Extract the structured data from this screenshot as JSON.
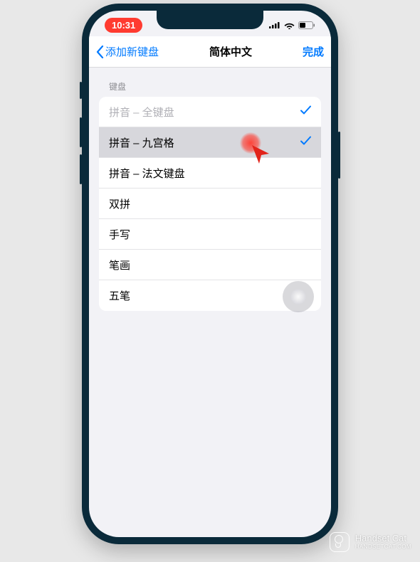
{
  "status": {
    "time": "10:31"
  },
  "nav": {
    "back": "添加新键盘",
    "title": "简体中文",
    "done": "完成"
  },
  "section": {
    "header": "键盘"
  },
  "keyboards": [
    {
      "label": "拼音 – 全键盘",
      "checked": true
    },
    {
      "label": "拼音 – 九宫格",
      "checked": true
    },
    {
      "label": "拼音 – 法文键盘",
      "checked": false
    },
    {
      "label": "双拼",
      "checked": false
    },
    {
      "label": "手写",
      "checked": false
    },
    {
      "label": "笔画",
      "checked": false
    },
    {
      "label": "五笔",
      "checked": false
    }
  ],
  "watermark": {
    "name": "Handset Cat",
    "url": "HANDSETCAT.COM"
  }
}
